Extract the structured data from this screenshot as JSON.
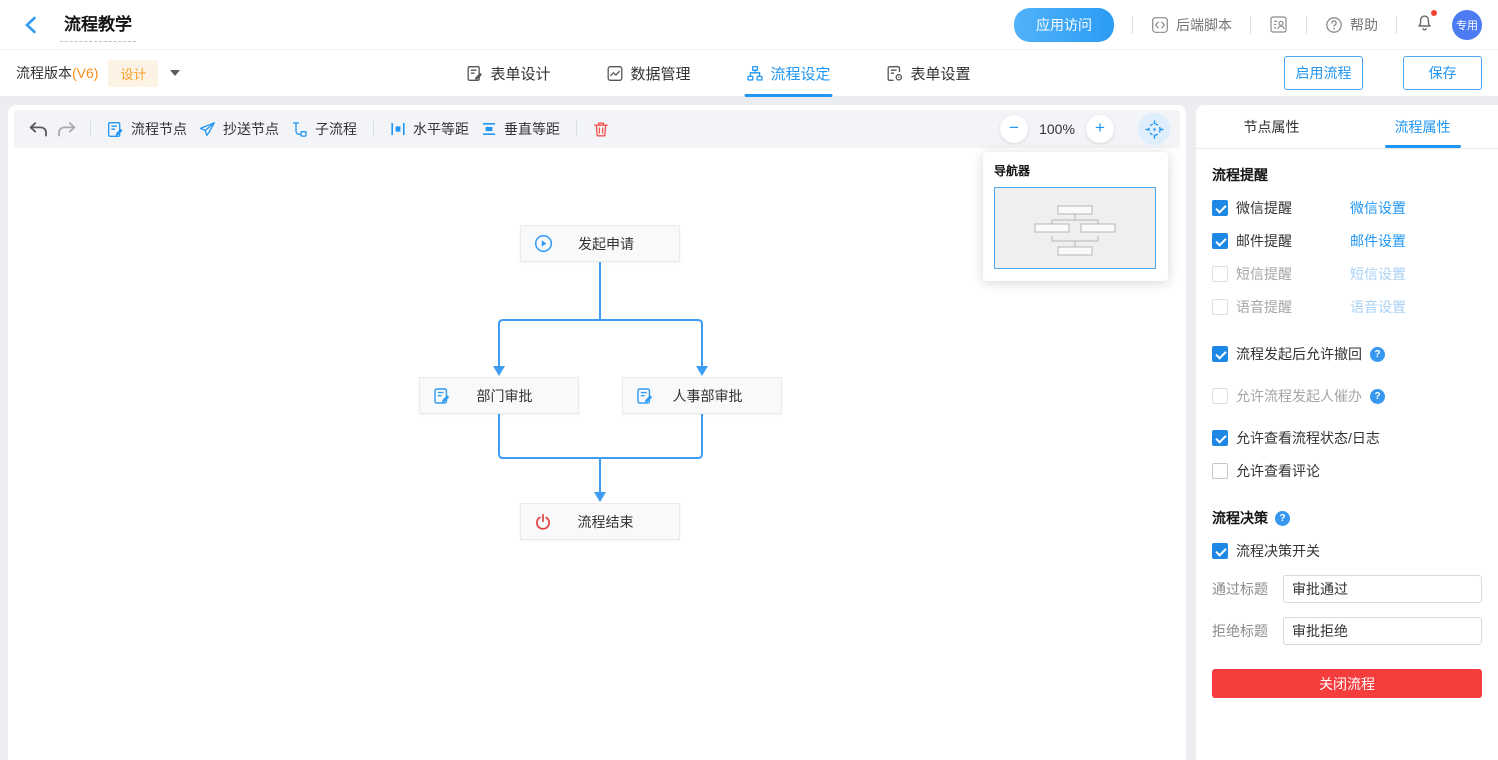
{
  "header": {
    "title": "流程教学",
    "app_access": "应用访问",
    "backend_script": "后端脚本",
    "help": "帮助",
    "avatar": "专用"
  },
  "subheader": {
    "version_label": "流程版本",
    "version": "(V6)",
    "design_badge": "设计",
    "tabs": [
      {
        "label": "表单设计"
      },
      {
        "label": "数据管理"
      },
      {
        "label": "流程设定"
      },
      {
        "label": "表单设置"
      }
    ],
    "active_tab": "流程设定",
    "enable_button": "启用流程",
    "save_button": "保存"
  },
  "toolbar": {
    "node_button": "流程节点",
    "cc_button": "抄送节点",
    "subflow_button": "子流程",
    "h_space_button": "水平等距",
    "v_space_button": "垂直等距",
    "zoom_level": "100%"
  },
  "navigator": {
    "title": "导航器"
  },
  "canvas": {
    "nodes": [
      {
        "label": "发起申请",
        "type": "start"
      },
      {
        "label": "部门审批",
        "type": "approval"
      },
      {
        "label": "人事部审批",
        "type": "approval"
      },
      {
        "label": "流程结束",
        "type": "end"
      }
    ]
  },
  "sidebar": {
    "tabs": [
      {
        "label": "节点属性"
      },
      {
        "label": "流程属性"
      }
    ],
    "active_tab": "流程属性",
    "reminder_section": "流程提醒",
    "reminders": [
      {
        "label": "微信提醒",
        "link": "微信设置",
        "checked": true,
        "disabled": false
      },
      {
        "label": "邮件提醒",
        "link": "邮件设置",
        "checked": true,
        "disabled": false
      },
      {
        "label": "短信提醒",
        "link": "短信设置",
        "checked": false,
        "disabled": true
      },
      {
        "label": "语音提醒",
        "link": "语音设置",
        "checked": false,
        "disabled": true
      }
    ],
    "options": [
      {
        "label": "流程发起后允许撤回",
        "checked": true,
        "help": true,
        "muted": false
      },
      {
        "label": "允许流程发起人催办",
        "checked": false,
        "help": true,
        "muted": true
      },
      {
        "label": "允许查看流程状态/日志",
        "checked": true,
        "help": false,
        "muted": false
      },
      {
        "label": "允许查看评论",
        "checked": false,
        "help": false,
        "muted": false
      }
    ],
    "decision_section": "流程决策",
    "decision_switch": "流程决策开关",
    "fields": [
      {
        "label": "通过标题",
        "value": "审批通过"
      },
      {
        "label": "拒绝标题",
        "value": "审批拒绝"
      }
    ],
    "close_button": "关闭流程"
  },
  "colors": {
    "accent": "#2196f3",
    "connector": "#3d9df2",
    "danger": "#f53d3d",
    "orange": "#fa8c16"
  }
}
